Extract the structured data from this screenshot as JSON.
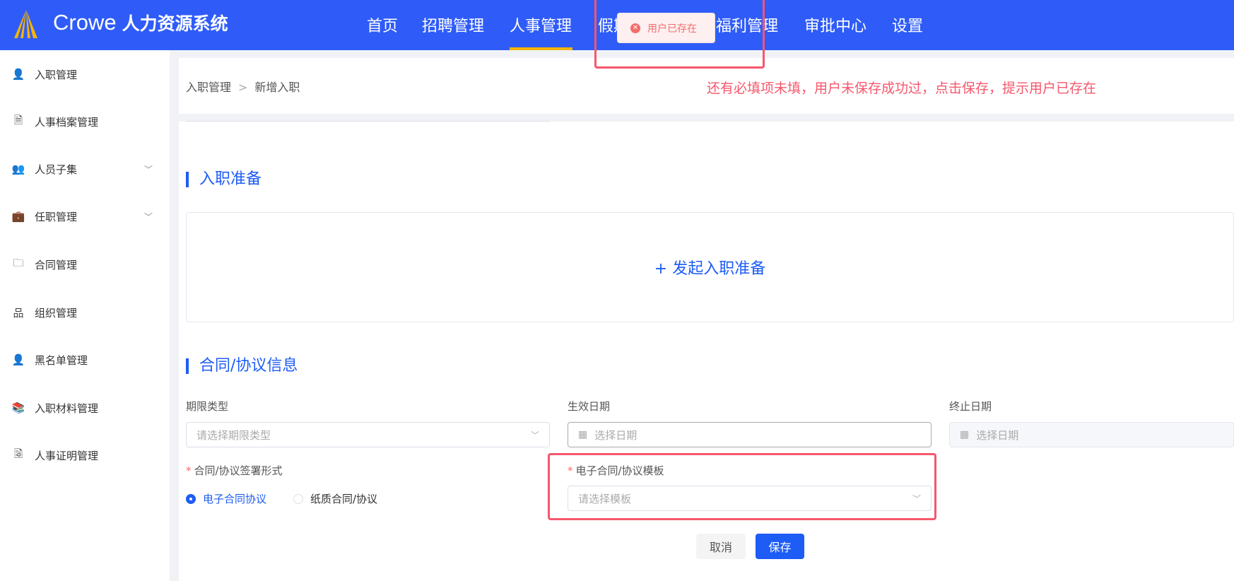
{
  "header": {
    "brand": "Crowe",
    "system_name": "人力资源系统",
    "nav": [
      "首页",
      "招聘管理",
      "人事管理",
      "假期",
      "福利管理",
      "审批中心",
      "设置"
    ],
    "active_nav": "人事管理"
  },
  "toast": {
    "message": "用户已存在",
    "type": "error"
  },
  "sidebar": {
    "items": [
      {
        "label": "入职管理",
        "icon": "user-add-icon"
      },
      {
        "label": "人事档案管理",
        "icon": "document-icon"
      },
      {
        "label": "人员子集",
        "icon": "users-icon",
        "expandable": true
      },
      {
        "label": "任职管理",
        "icon": "briefcase-icon",
        "expandable": true
      },
      {
        "label": "合同管理",
        "icon": "contract-icon"
      },
      {
        "label": "组织管理",
        "icon": "org-icon"
      },
      {
        "label": "黑名单管理",
        "icon": "user-block-icon"
      },
      {
        "label": "入职材料管理",
        "icon": "books-icon"
      },
      {
        "label": "人事证明管理",
        "icon": "certificate-icon"
      }
    ]
  },
  "breadcrumb": [
    "入职管理",
    "新增入职"
  ],
  "annotation": "还有必填项未填，用户未保存成功过，点击保存，提示用户已存在",
  "prep": {
    "title": "入职准备",
    "action": "+ 发起入职准备"
  },
  "contract": {
    "title": "合同/协议信息",
    "term_type": {
      "label": "期限类型",
      "placeholder": "请选择期限类型"
    },
    "start_date": {
      "label": "生效日期",
      "placeholder": "选择日期"
    },
    "end_date": {
      "label": "终止日期",
      "placeholder": "选择日期"
    },
    "sign_form": {
      "label": "合同/协议签署形式",
      "options": [
        "电子合同协议",
        "纸质合同/协议"
      ],
      "selected": "电子合同协议"
    },
    "template": {
      "label": "电子合同/协议模板",
      "placeholder": "请选择模板"
    }
  },
  "buttons": {
    "cancel": "取消",
    "save": "保存"
  },
  "colors": {
    "header": "#2f5cf8",
    "accent": "#1d5cf5",
    "error": "#f56c6c",
    "annotation": "#f5576c"
  }
}
